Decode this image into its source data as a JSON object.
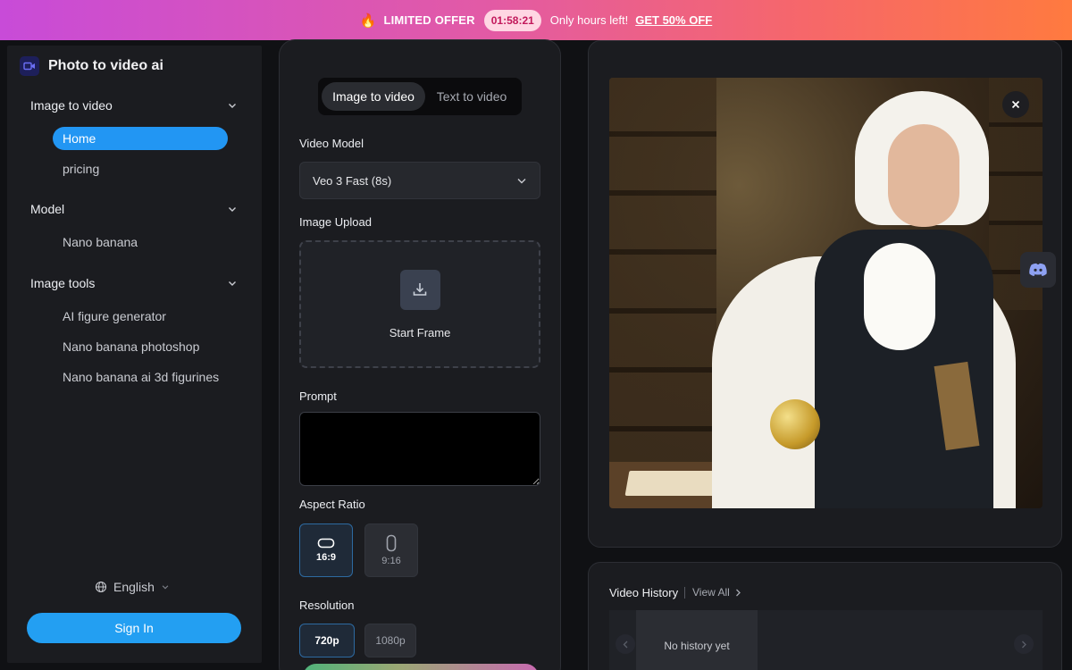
{
  "promo": {
    "offer_label": "LIMITED OFFER",
    "timer": "01:58:21",
    "hours_text": "Only hours left!",
    "cta": "GET 50% OFF"
  },
  "sidebar": {
    "brand_title": "Photo to video ai",
    "groups": [
      {
        "label": "Image to video",
        "items": [
          "Home",
          "pricing"
        ]
      },
      {
        "label": "Model",
        "items": [
          "Nano banana"
        ]
      },
      {
        "label": "Image tools",
        "items": [
          "AI figure generator",
          "Nano banana photoshop",
          "Nano banana ai 3d figurines"
        ]
      }
    ],
    "active_item": "Home",
    "language": "English",
    "signin_label": "Sign In"
  },
  "form": {
    "tabs": [
      {
        "label": "Image to video",
        "selected": true
      },
      {
        "label": "Text to video",
        "selected": false
      }
    ],
    "video_model_label": "Video Model",
    "video_model_value": "Veo 3 Fast (8s)",
    "image_upload_label": "Image Upload",
    "start_frame_label": "Start Frame",
    "prompt_label": "Prompt",
    "prompt_value": "",
    "aspect_ratio_label": "Aspect Ratio",
    "aspect_ratios": [
      {
        "label": "16:9",
        "selected": true
      },
      {
        "label": "9:16",
        "selected": false
      }
    ],
    "resolution_label": "Resolution",
    "resolutions": [
      {
        "label": "720p",
        "selected": true
      },
      {
        "label": "1080p",
        "selected": false
      }
    ]
  },
  "history": {
    "title": "Video History",
    "view_all": "View All",
    "empty_text": "No history yet"
  },
  "colors": {
    "accent": "#2296f3",
    "panel": "#1b1c20",
    "background": "#101114"
  }
}
